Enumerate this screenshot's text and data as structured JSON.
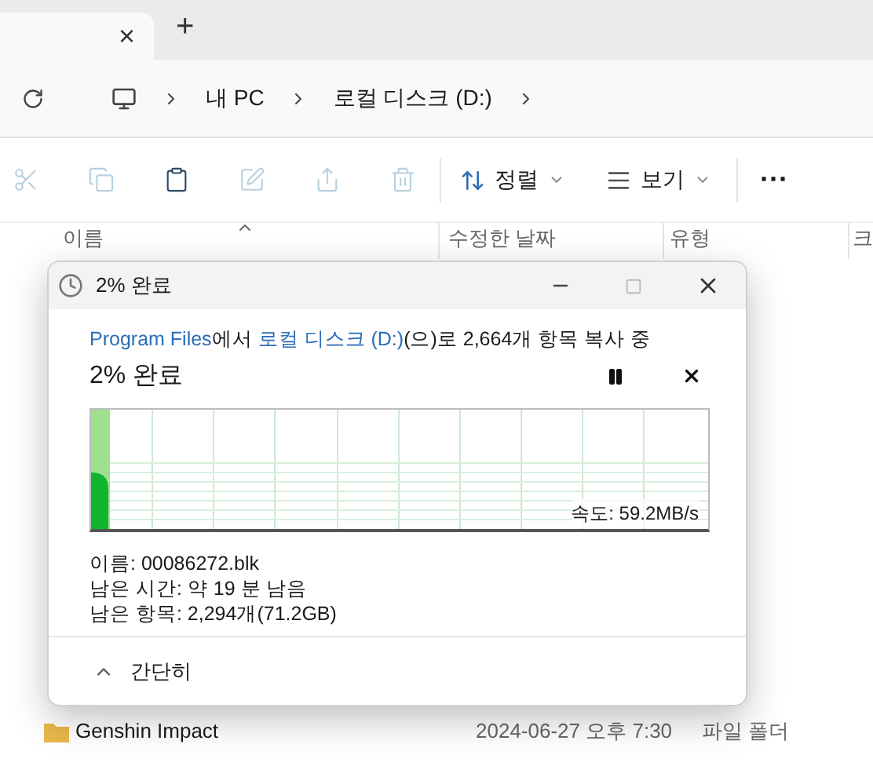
{
  "tab_bar": {
    "close_label": "×",
    "new_tab_label": "+"
  },
  "address_bar": {
    "crumbs": [
      "내 PC",
      "로컬 디스크 (D:)"
    ]
  },
  "toolbar": {
    "buttons": [
      {
        "kind": "cut",
        "disabled": true
      },
      {
        "kind": "copy",
        "disabled": true
      },
      {
        "kind": "paste",
        "disabled": false
      },
      {
        "kind": "rename",
        "disabled": true
      },
      {
        "kind": "share",
        "disabled": true
      },
      {
        "kind": "delete",
        "disabled": true
      }
    ],
    "sort_label": "정렬",
    "view_label": "보기",
    "more_label": "···"
  },
  "columns": [
    "이름",
    "수정한 날짜",
    "유형",
    "크"
  ],
  "file_rows": [
    {
      "name": "Genshin Impact",
      "modified": "2024-06-27 오후 7:30",
      "type": "파일 폴더"
    }
  ],
  "dialog": {
    "title": "2% 완료",
    "status_parts": [
      {
        "kind": "link",
        "text": "Program Files"
      },
      {
        "kind": "text",
        "text": "에서 "
      },
      {
        "kind": "link",
        "text": "로컬 디스크 (D:)"
      },
      {
        "kind": "text",
        "text": "(으)로 2,664개 항목 복사 중"
      }
    ],
    "heading": "2% 완료",
    "level": 0.03,
    "speed": "속도: 59.2MB/s",
    "details": [
      "이름: 00086272.blk",
      "남은 시간: 약 19 분 남음",
      "남은 항목: 2,294개(71.2GB)"
    ],
    "collapse_label": "간단히"
  }
}
